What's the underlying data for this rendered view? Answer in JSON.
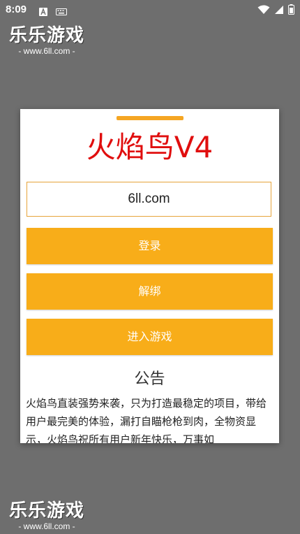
{
  "status_bar": {
    "time": "8:09",
    "left_icons": [
      "text-a-icon",
      "keyboard-icon"
    ],
    "right_icons": [
      "wifi-icon",
      "signal-icon",
      "battery-icon"
    ]
  },
  "watermark": {
    "title": "乐乐游戏",
    "subtitle": "- www.6ll.com -"
  },
  "dialog": {
    "title": "火焰鸟V4",
    "input_value": "6ll.com",
    "buttons": {
      "login": "登录",
      "unbind": "解绑",
      "enter_game": "进入游戏"
    },
    "notice_title": "公告",
    "notice_text": "火焰鸟直装强势来袭，只为打造最稳定的项目，带给用户最完美的体验，漏打自瞄枪枪到肉，全物资显示，火焰鸟祝所有用户新年快乐，万事如"
  },
  "colors": {
    "accent": "#f8ad19",
    "title_red": "#e00e0e",
    "background": "#6e6e6e"
  }
}
